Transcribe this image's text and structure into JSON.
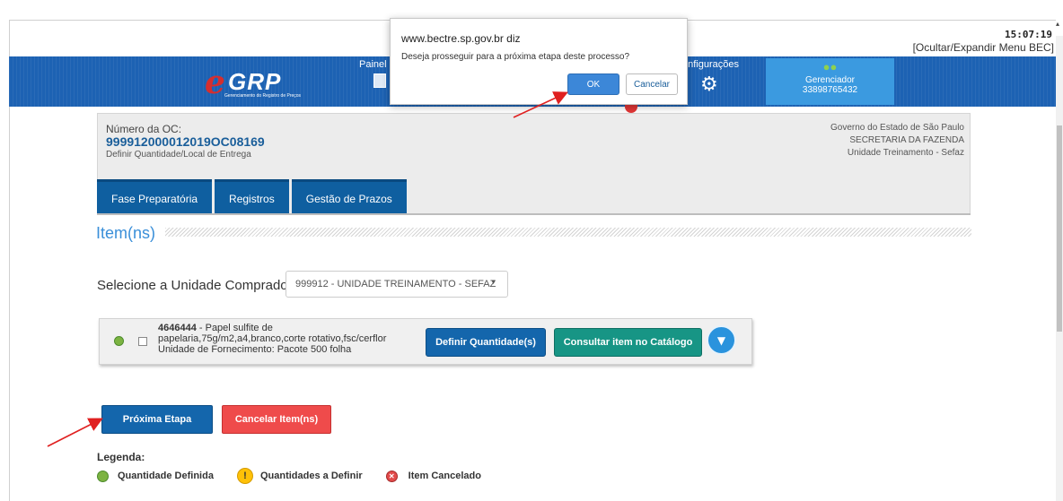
{
  "header": {
    "time": "15:07:19",
    "toggle_menu": "[Ocultar/Expandir Menu BEC]",
    "logo_e": "e",
    "logo_text": "GRP",
    "logo_subtitle": "Gerenciamento do Registro de Preços",
    "menu_painel": "Painel d",
    "menu_config": "onfigurações",
    "user_role": "Gerenciador",
    "user_id": "33898765432"
  },
  "info": {
    "oc_label": "Número da OC:",
    "oc_number": "999912000012019OC08169",
    "oc_desc": "Definir Quantidade/Local de Entrega",
    "gov_line1": "Governo do Estado de São Paulo",
    "gov_line2": "SECRETARIA DA FAZENDA",
    "gov_line3": "Unidade Treinamento - Sefaz"
  },
  "tabs": [
    {
      "label": "Fase Preparatória"
    },
    {
      "label": "Registros"
    },
    {
      "label": "Gestão de Prazos"
    }
  ],
  "items_section": {
    "title": "Item(ns)",
    "select_label": "Selecione a Unidade Compradora:",
    "select_value": "999912 - UNIDADE TREINAMENTO - SEFAZ"
  },
  "item": {
    "code": "4646444",
    "desc_part1": " - Papel sulfite de",
    "desc_part2": "papelaria,75g/m2,a4,branco,corte rotativo,fsc/cerflor",
    "unit": "Unidade de Fornecimento:  Pacote 500 folha",
    "btn_define": "Definir Quantidade(s)",
    "btn_catalog": "Consultar item no Catálogo"
  },
  "actions": {
    "next": "Próxima Etapa",
    "cancel": "Cancelar Item(ns)"
  },
  "legend": {
    "title": "Legenda:",
    "defined": "Quantidade Definida",
    "to_define": "Quantidades a Definir",
    "cancelled": "Item Cancelado"
  },
  "dialog": {
    "site": "www.bectre.sp.gov.br diz",
    "message": "Deseja prosseguir para a próxima etapa deste processo?",
    "ok": "OK",
    "cancel": "Cancelar"
  },
  "colors": {
    "banner": "#1d62b3",
    "tab": "#0f5fa0",
    "primary_button": "#1466ac",
    "catalog_button": "#179585",
    "cancel_button": "#ef4b4b",
    "link_title": "#3a8fd9",
    "annotation_arrow": "#e02020"
  }
}
